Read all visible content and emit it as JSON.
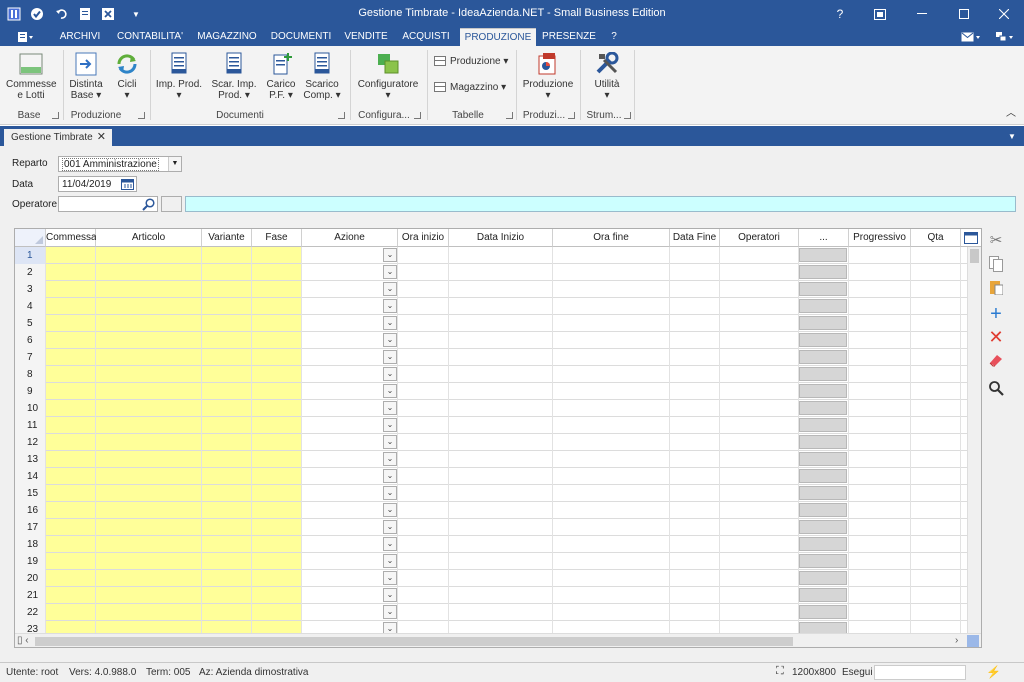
{
  "window": {
    "title": "Gestione Timbrate - IdeaAzienda.NET - Small Business Edition",
    "help_label": "?"
  },
  "menu": {
    "tabs": [
      "ARCHIVI",
      "CONTABILITA'",
      "MAGAZZINO",
      "DOCUMENTI",
      "VENDITE",
      "ACQUISTI",
      "PRODUZIONE",
      "PRESENZE",
      "?"
    ],
    "active": "PRODUZIONE"
  },
  "ribbon": {
    "commesse": "Commesse\ne Lotti",
    "distinta": "Distinta\nBase ▾",
    "cicli": "Cicli\n▾",
    "imp_prod": "Imp. Prod.\n▾",
    "scar_imp": "Scar. Imp.\nProd. ▾",
    "carico_pf": "Carico\nP.F. ▾",
    "scarico_comp": "Scarico\nComp. ▾",
    "configuratore": "Configuratore\n▾",
    "tab_produzione": "Produzione ▾",
    "tab_magazzino": "Magazzino ▾",
    "produzione": "Produzione\n▾",
    "utilita": "Utilità\n▾",
    "groups": [
      "Base",
      "Produzione",
      "Documenti",
      "Configura...",
      "Tabelle",
      "Produzi...",
      "Strum..."
    ]
  },
  "document_tab": {
    "label": "Gestione Timbrate",
    "close": "✕"
  },
  "form": {
    "reparto_label": "Reparto",
    "reparto_value": "001 Amministrazione",
    "data_label": "Data",
    "data_value": "11/04/2019",
    "operatore_label": "Operatore",
    "operatore_value": ""
  },
  "grid": {
    "columns": [
      "Commessa",
      "Articolo",
      "Variante",
      "Fase",
      "Azione",
      "Ora inizio",
      "Data Inizio",
      "Ora fine",
      "Data Fine",
      "Operatori",
      "...",
      "Progressivo",
      "Qta"
    ],
    "rows": [
      "1",
      "2",
      "3",
      "4",
      "5",
      "6",
      "7",
      "8",
      "9",
      "10",
      "11",
      "12",
      "13",
      "14",
      "15",
      "16",
      "17",
      "18",
      "19",
      "20",
      "21",
      "22",
      "23"
    ]
  },
  "toolbar_icons": [
    "cut-icon",
    "copy-icon",
    "paste-icon",
    "add-icon",
    "delete-icon",
    "eraser-icon",
    "search-icon"
  ],
  "status": {
    "utente": "Utente: root",
    "vers": "Vers: 4.0.988.0",
    "term": "Term: 005",
    "azienda": "Az: Azienda dimostrativa",
    "resolution": "1200x800",
    "esegui": "Esegui"
  },
  "colors": {
    "accent": "#2b579a",
    "yellow_cells": "#ffff99",
    "operator_field": "#ccffff"
  }
}
